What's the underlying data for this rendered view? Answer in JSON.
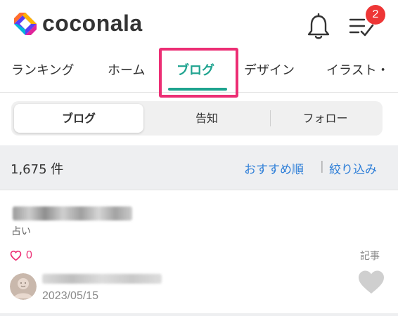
{
  "header": {
    "logo_text": "coconala",
    "notification_count": "2"
  },
  "tabs": [
    {
      "label": "ランキング"
    },
    {
      "label": "ホーム"
    },
    {
      "label": "ブログ",
      "active": true
    },
    {
      "label": "デザイン"
    },
    {
      "label": "イラスト・"
    }
  ],
  "segments": [
    {
      "label": "ブログ",
      "active": true
    },
    {
      "label": "告知"
    },
    {
      "label": "フォロー"
    }
  ],
  "results": {
    "count": "1,675 件",
    "sort_label": "おすすめ順",
    "separator": "|",
    "filter_label": "絞り込み"
  },
  "post": {
    "category": "占い",
    "likes": "0",
    "type": "記事",
    "date": "2023/05/15"
  },
  "colors": {
    "accent": "#1ea38f",
    "highlight": "#ec2e74",
    "link": "#2f7fd8",
    "badge": "#ee3636"
  }
}
